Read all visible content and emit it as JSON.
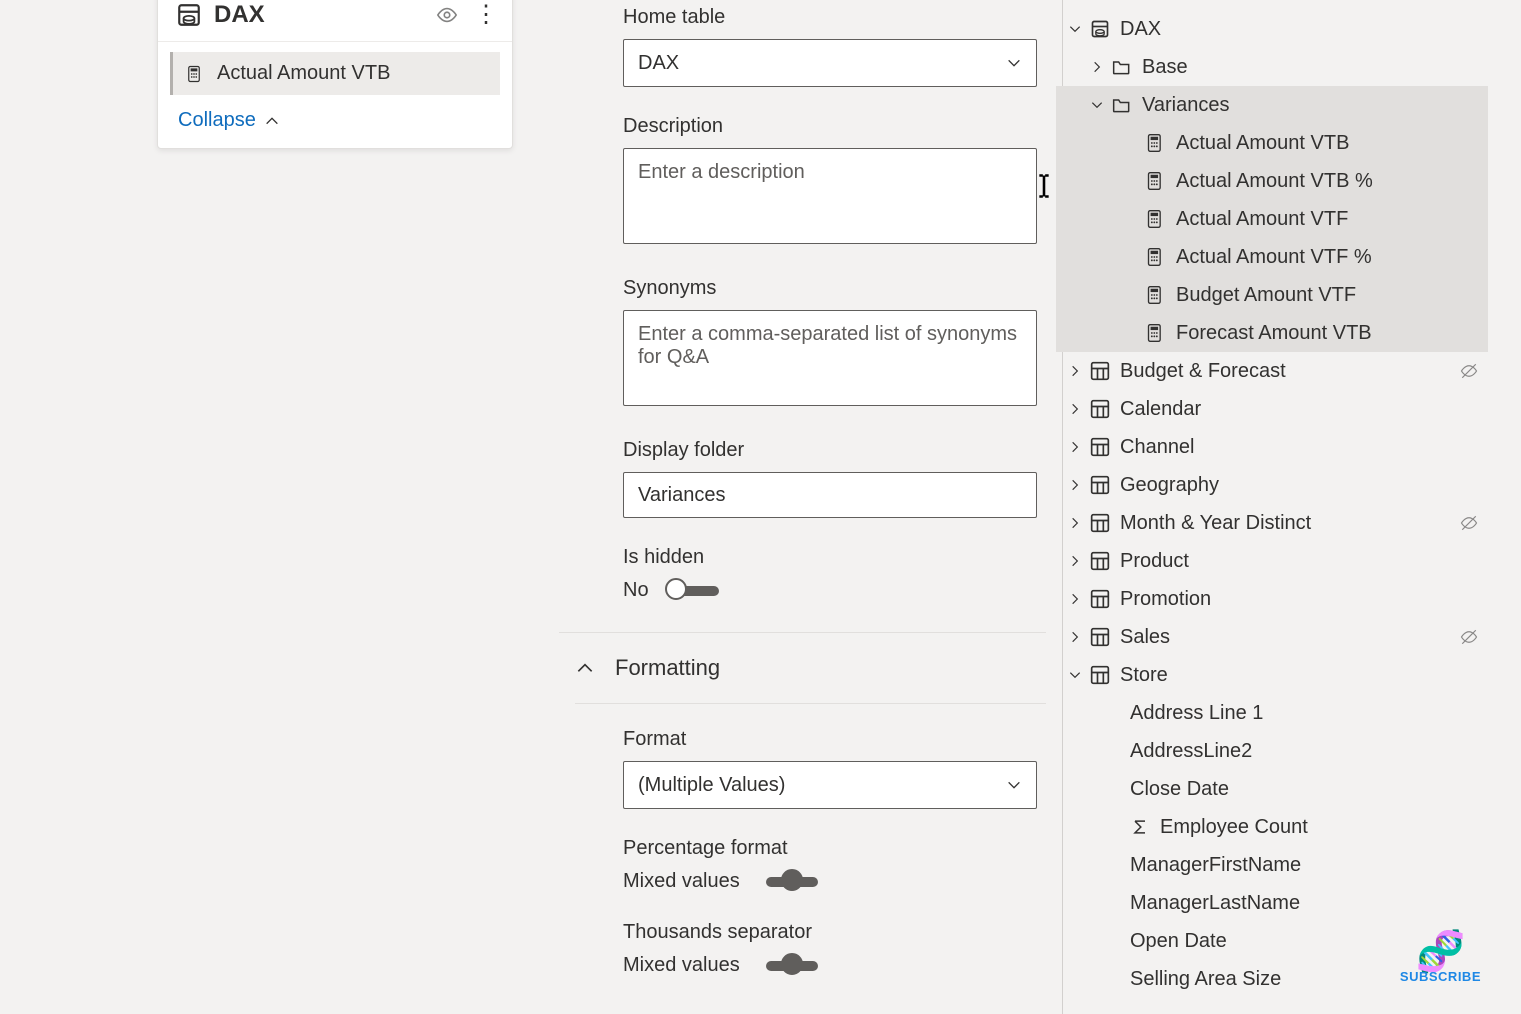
{
  "card": {
    "title": "DAX",
    "selected_row": "Actual Amount VTB",
    "collapse": "Collapse"
  },
  "props": {
    "home_table_label": "Home table",
    "home_table_value": "DAX",
    "description_label": "Description",
    "description_placeholder": "Enter a description",
    "synonyms_label": "Synonyms",
    "synonyms_placeholder": "Enter a comma-separated list of synonyms for Q&A",
    "display_folder_label": "Display folder",
    "display_folder_value": "Variances",
    "is_hidden_label": "Is hidden",
    "is_hidden_value": "No",
    "formatting_header": "Formatting",
    "format_label": "Format",
    "format_value": "(Multiple Values)",
    "percentage_label": "Percentage format",
    "percentage_value": "Mixed values",
    "thousands_label": "Thousands separator",
    "thousands_value": "Mixed values"
  },
  "tree": {
    "root": "DAX",
    "folders": {
      "base": "Base",
      "variances": "Variances"
    },
    "variance_measures": [
      "Actual Amount VTB",
      "Actual Amount VTB %",
      "Actual Amount VTF",
      "Actual Amount VTF %",
      "Budget Amount VTF",
      "Forecast Amount VTB"
    ],
    "tables": [
      {
        "name": "Budget & Forecast",
        "hidden": true
      },
      {
        "name": "Calendar",
        "hidden": false
      },
      {
        "name": "Channel",
        "hidden": false
      },
      {
        "name": "Geography",
        "hidden": false
      },
      {
        "name": "Month & Year Distinct",
        "hidden": true
      },
      {
        "name": "Product",
        "hidden": false
      },
      {
        "name": "Promotion",
        "hidden": false
      },
      {
        "name": "Sales",
        "hidden": true
      },
      {
        "name": "Store",
        "hidden": false,
        "expanded": true
      }
    ],
    "store_columns": [
      {
        "name": "Address Line 1",
        "sigma": false
      },
      {
        "name": "AddressLine2",
        "sigma": false
      },
      {
        "name": "Close Date",
        "sigma": false
      },
      {
        "name": "Employee Count",
        "sigma": true
      },
      {
        "name": "ManagerFirstName",
        "sigma": false
      },
      {
        "name": "ManagerLastName",
        "sigma": false
      },
      {
        "name": "Open Date",
        "sigma": false
      },
      {
        "name": "Selling Area Size",
        "sigma": false
      }
    ]
  },
  "subscribe": "SUBSCRIBE"
}
